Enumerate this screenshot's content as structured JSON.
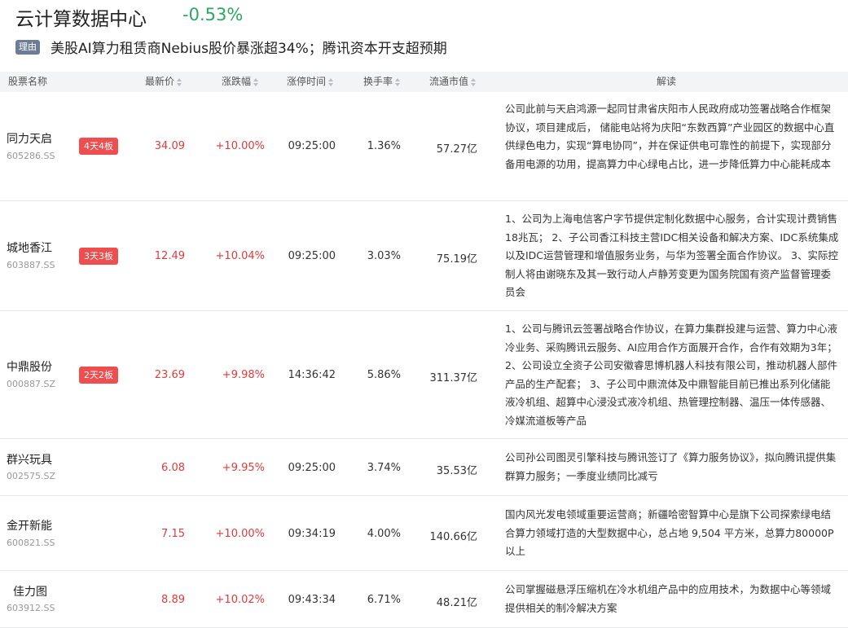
{
  "header": {
    "title": "云计算数据中心",
    "change": "-0.53%",
    "reason_badge": "理由",
    "reason_text": "美股AI算力租赁商Nebius股价暴涨超34%；腾讯资本开支超预期"
  },
  "columns": {
    "name": "股票名称",
    "price": "最新价",
    "pct": "涨跌幅",
    "limit_time": "涨停时间",
    "turnover": "换手率",
    "market_cap": "流通市值",
    "desc": "解读"
  },
  "colors": {
    "up": "#e03b3b",
    "down": "#2aa862",
    "tag_bg": "#ee4e4e",
    "header_bg": "#f3f4f6"
  },
  "rows": [
    {
      "name": "同力天启",
      "code": "605286.SS",
      "tag": "4天4板",
      "price": "34.09",
      "pct": "+10.00%",
      "time": "09:25:00",
      "turnover": "1.36%",
      "cap": "57.27亿",
      "desc": "公司此前与天启鸿源一起同甘肃省庆阳市人民政府成功签署战略合作框架协议，项目建成后，  储能电站将为庆阳“东数西算”产业园区的数据中心直供绿色电力，实现“算电协同”，并在保证供电可靠性的前提下，实现部分备用电源的功用，提高算力中心绿电占比，进一步降低算力中心能耗成本"
    },
    {
      "name": "城地香江",
      "code": "603887.SS",
      "tag": "3天3板",
      "price": "12.49",
      "pct": "+10.04%",
      "time": "09:25:00",
      "turnover": "3.03%",
      "cap": "75.19亿",
      "desc": "1、公司为上海电信客户字节提供定制化数据中心服务，合计实现计费销售18兆瓦；  2、子公司香江科技主营IDC相关设备和解决方案、IDC系统集成以及IDC运营管理和增值服务业务，与华为签署全面合作协议。  3、实际控制人将由谢晓东及其一致行动人卢静芳变更为国务院国有资产监督管理委员会"
    },
    {
      "name": "中鼎股份",
      "code": "000887.SZ",
      "tag": "2天2板",
      "price": "23.69",
      "pct": "+9.98%",
      "time": "14:36:42",
      "turnover": "5.86%",
      "cap": "311.37亿",
      "desc": "1、公司与腾讯云签署战略合作协议，在算力集群投建与运营、算力中心液冷业务、采购腾讯云服务、AI应用合作方面展开合作，合作有效期为3年；  2、公司设立全资子公司安徽睿思博机器人科技有限公司，推动机器人部件产品的生产配套；  3、子公司中鼎流体及中鼎智能目前已推出系列化储能液冷机组、超算中心浸没式液冷机组、热管理控制器、温压一体传感器、冷媒流道板等产品"
    },
    {
      "name": "群兴玩具",
      "code": "002575.SZ",
      "tag": "",
      "price": "6.08",
      "pct": "+9.95%",
      "time": "09:25:00",
      "turnover": "3.74%",
      "cap": "35.53亿",
      "desc": "公司孙公司图灵引擎科技与腾讯签订了《算力服务协议》，拟向腾讯提供集群算力服务；一季度业绩同比减亏"
    },
    {
      "name": "金开新能",
      "code": "600821.SS",
      "tag": "",
      "price": "7.15",
      "pct": "+10.00%",
      "time": "09:34:19",
      "turnover": "4.00%",
      "cap": "140.66亿",
      "desc": "国内风光发电领域重要运营商；新疆哈密智算中心是旗下公司探索绿电结合算力领域打造的大型数据中心，总占地 9,504 平方米，总算力80000P以上"
    },
    {
      "name": "佳力图",
      "code": "603912.SS",
      "tag": "",
      "price": "8.89",
      "pct": "+10.02%",
      "time": "09:43:34",
      "turnover": "6.71%",
      "cap": "48.21亿",
      "desc": "公司掌握磁悬浮压缩机在冷水机组产品中的应用技术，为数据中心等领域提供相关的制冷解决方案"
    }
  ]
}
